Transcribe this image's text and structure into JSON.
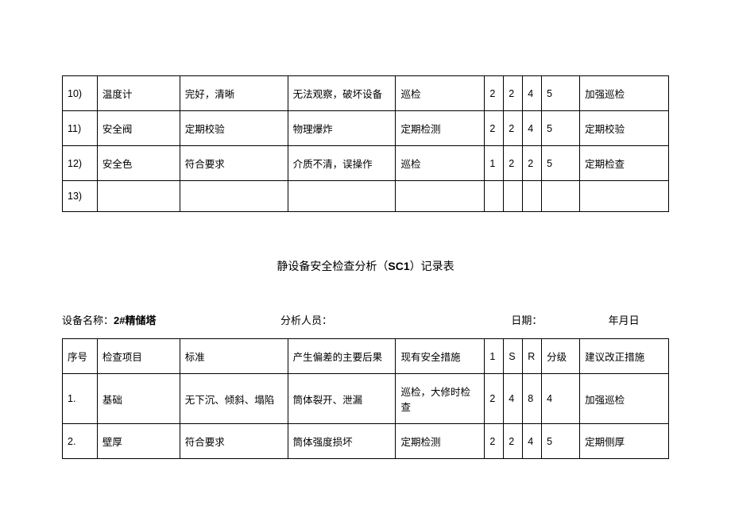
{
  "table1": {
    "rows": [
      {
        "idx": "10)",
        "item": "温度计",
        "std": "完好，清晰",
        "cons": "无法观察，破坏设备",
        "meas": "巡检",
        "n1": "2",
        "n2": "2",
        "n3": "4",
        "n4": "5",
        "sugg": "加强巡检"
      },
      {
        "idx": "11)",
        "item": "安全阀",
        "std": "定期校验",
        "cons": "物理爆炸",
        "meas": "定期检测",
        "n1": "2",
        "n2": "2",
        "n3": "4",
        "n4": "5",
        "sugg": "定期校验"
      },
      {
        "idx": "12)",
        "item": "安全色",
        "std": "符合要求",
        "cons": "介质不清，误操作",
        "meas": "巡检",
        "n1": "1",
        "n2": "2",
        "n3": "2",
        "n4": "5",
        "sugg": "定期检查"
      },
      {
        "idx": "13)",
        "item": "",
        "std": "",
        "cons": "",
        "meas": "",
        "n1": "",
        "n2": "",
        "n3": "",
        "n4": "",
        "sugg": ""
      }
    ]
  },
  "title": {
    "pre": "静设备安全检查分析（",
    "code": "SC1",
    "post": "）记录表"
  },
  "meta": {
    "name_label": "设备名称：",
    "name_value": "2#精储塔",
    "analyst_label": "分析人员：",
    "date_label": "日期：",
    "date_value": "年月日"
  },
  "table2": {
    "header": {
      "idx": "序号",
      "item": "检查项目",
      "std": "标准",
      "cons": "产生偏差的主要后果",
      "meas": "现有安全措施",
      "n1": "1",
      "n2": "S",
      "n3": "R",
      "n4": "分级",
      "sugg": "建议改正措施"
    },
    "rows": [
      {
        "idx": "1.",
        "item": "基础",
        "std": "无下沉、倾斜、塌陷",
        "cons": "筒体裂开、泄漏",
        "meas": "巡检，大修时检查",
        "n1": "2",
        "n2": "4",
        "n3": "8",
        "n4": "4",
        "sugg": "加强巡检"
      },
      {
        "idx": "2.",
        "item": "壁厚",
        "std": "符合要求",
        "cons": "筒体强度损坏",
        "meas": "定期检测",
        "n1": "2",
        "n2": "2",
        "n3": "4",
        "n4": "5",
        "sugg": "定期侧厚"
      }
    ]
  }
}
